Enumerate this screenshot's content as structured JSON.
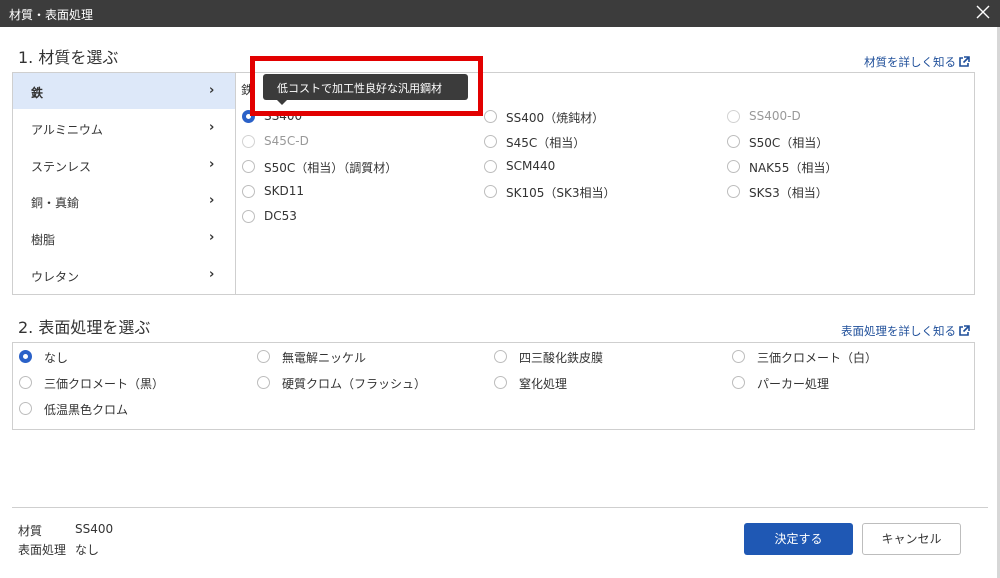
{
  "window": {
    "title": "材質・表面処理"
  },
  "material_section": {
    "title": "1. 材質を選ぶ",
    "detail_link": "材質を詳しく知る",
    "categories": [
      {
        "label": "鉄",
        "selected": true
      },
      {
        "label": "アルミニウム",
        "selected": false
      },
      {
        "label": "ステンレス",
        "selected": false
      },
      {
        "label": "銅・真鍮",
        "selected": false
      },
      {
        "label": "樹脂",
        "selected": false
      },
      {
        "label": "ウレタン",
        "selected": false
      }
    ],
    "group_label_partial": "鉄",
    "options": [
      {
        "label": "SS400",
        "checked": true,
        "disabled": false
      },
      {
        "label": "SS400（焼鈍材）",
        "checked": false,
        "disabled": false
      },
      {
        "label": "SS400-D",
        "checked": false,
        "disabled": true
      },
      {
        "label": "S45C-D",
        "checked": false,
        "disabled": true
      },
      {
        "label": "S45C（相当）",
        "checked": false,
        "disabled": false
      },
      {
        "label": "S50C（相当）",
        "checked": false,
        "disabled": false
      },
      {
        "label": "S50C（相当）（調質材）",
        "checked": false,
        "disabled": false
      },
      {
        "label": "SCM440",
        "checked": false,
        "disabled": false
      },
      {
        "label": "NAK55（相当）",
        "checked": false,
        "disabled": false
      },
      {
        "label": "SKD11",
        "checked": false,
        "disabled": false
      },
      {
        "label": "SK105（SK3相当）",
        "checked": false,
        "disabled": false
      },
      {
        "label": "SKS3（相当）",
        "checked": false,
        "disabled": false
      },
      {
        "label": "DC53",
        "checked": false,
        "disabled": false
      }
    ],
    "tooltip": "低コストで加工性良好な汎用鋼材"
  },
  "surface_section": {
    "title": "2. 表面処理を選ぶ",
    "detail_link": "表面処理を詳しく知る",
    "options": [
      {
        "label": "なし",
        "checked": true
      },
      {
        "label": "無電解ニッケル",
        "checked": false
      },
      {
        "label": "四三酸化鉄皮膜",
        "checked": false
      },
      {
        "label": "三価クロメート（白）",
        "checked": false
      },
      {
        "label": "三価クロメート（黒）",
        "checked": false
      },
      {
        "label": "硬質クロム（フラッシュ）",
        "checked": false
      },
      {
        "label": "窒化処理",
        "checked": false
      },
      {
        "label": "パーカー処理",
        "checked": false
      },
      {
        "label": "低温黒色クロム",
        "checked": false
      }
    ]
  },
  "summary": {
    "material_label": "材質",
    "material_value": "SS400",
    "surface_label": "表面処理",
    "surface_value": "なし"
  },
  "buttons": {
    "confirm": "決定する",
    "cancel": "キャンセル"
  },
  "colors": {
    "accent": "#1f58b4",
    "highlight": "#e20000",
    "selected_bg": "#dde8f9"
  },
  "icons": {
    "close": "close-icon",
    "chevron": "chevron-right-icon",
    "external": "external-link-icon"
  }
}
